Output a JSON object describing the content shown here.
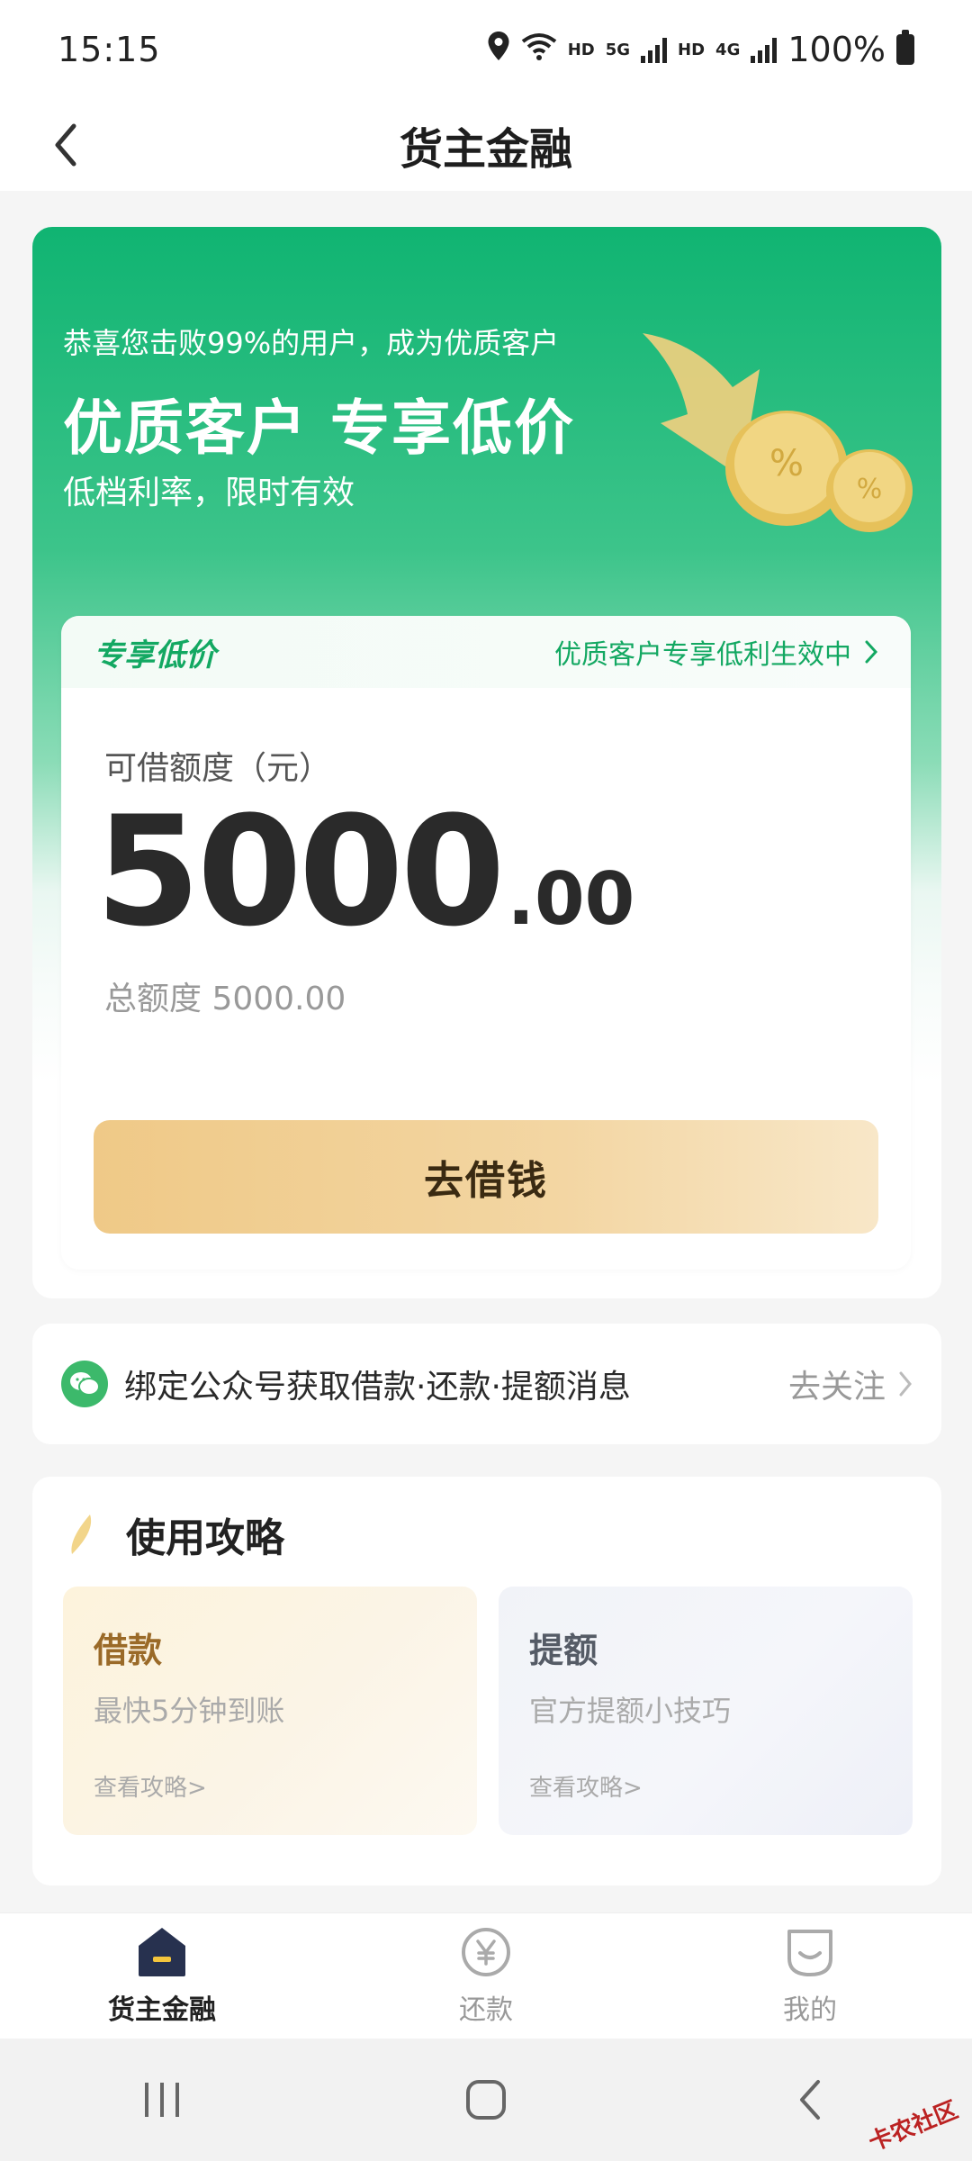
{
  "status_bar": {
    "time": "15:15",
    "net_hd_1": "HD",
    "net_5g": "5G",
    "net_hd_2": "HD",
    "net_4g": "4G",
    "battery": "100%"
  },
  "header": {
    "title": "货主金融",
    "back_icon": "chevron-left-icon"
  },
  "hero": {
    "subtitle": "恭喜您击败99%的用户，成为优质客户",
    "headline": "优质客户 专享低价",
    "desc": "低档利率，限时有效"
  },
  "credit": {
    "badge": "专享低价",
    "promo_text": "优质客户专享低利生效中",
    "label": "可借额度（元）",
    "amount_int": "5000",
    "amount_dec": ".00",
    "total": "总额度 5000.00",
    "borrow_button": "去借钱"
  },
  "follow_bar": {
    "text": "绑定公众号获取借款·还款·提额消息",
    "action": "去关注"
  },
  "guide": {
    "title": "使用攻略",
    "cards": [
      {
        "title": "借款",
        "subtitle": "最快5分钟到账",
        "link": "查看攻略>"
      },
      {
        "title": "提额",
        "subtitle": "官方提额小技巧",
        "link": "查看攻略>"
      }
    ]
  },
  "tabs": [
    {
      "label": "货主金融",
      "icon": "home-icon",
      "active": true
    },
    {
      "label": "还款",
      "icon": "yen-icon",
      "active": false
    },
    {
      "label": "我的",
      "icon": "profile-icon",
      "active": false
    }
  ],
  "watermark": "卡农社区",
  "colors": {
    "brand_green": "#10b472",
    "button_gold": "#efc987"
  }
}
